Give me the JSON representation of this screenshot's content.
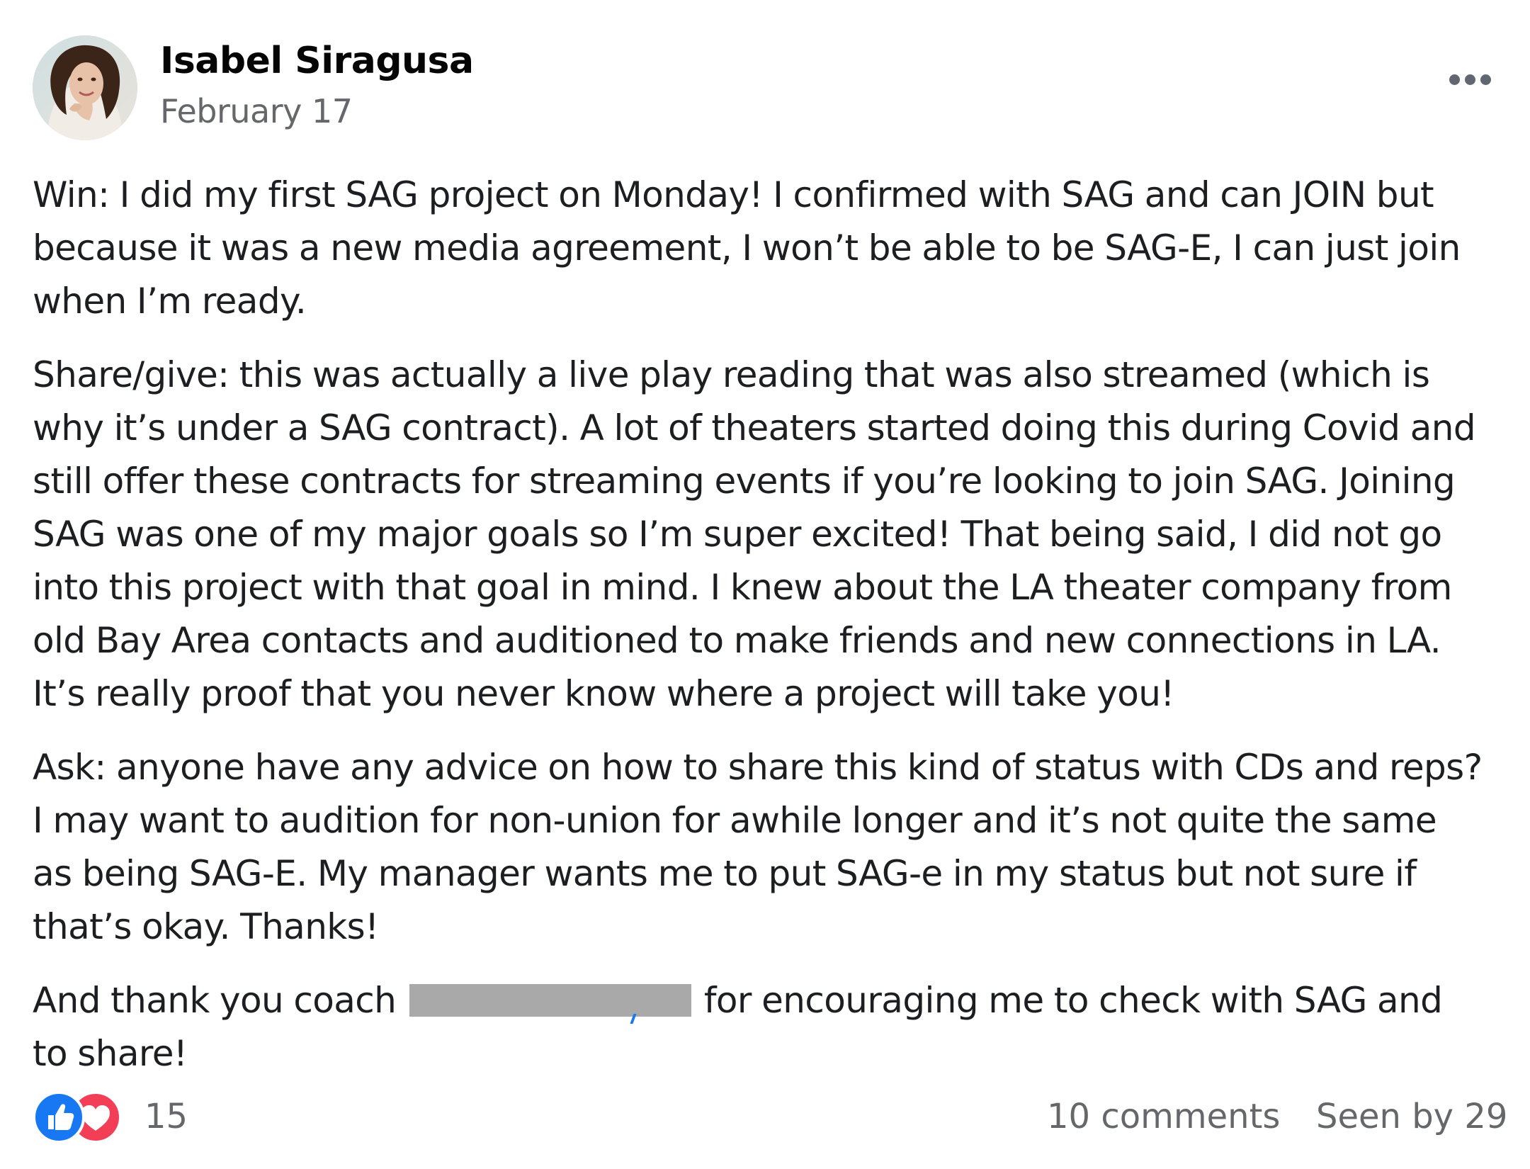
{
  "post": {
    "author_name": "Isabel Siragusa",
    "date": "February 17",
    "avatar_icon": "profile-photo",
    "more_icon": "ellipsis-icon",
    "paragraphs": [
      {
        "lines": [
          "Win: I did my first SAG project on Monday! I confirmed with SAG and can JOIN but",
          "because it was a new media agreement, I won’t be able to be SAG-E, I can just join",
          "when I’m ready."
        ]
      },
      {
        "lines": [
          "Share/give: this was actually a live play reading that was also streamed (which is",
          "why it’s under a SAG contract). A lot of theaters started doing this during Covid and",
          "still offer these contracts for streaming events if you’re looking to join SAG. Joining",
          "SAG was one of my major goals so I’m super excited! That being said, I did not go",
          "into this project with that goal in mind. I knew about the LA theater company from",
          "old Bay Area contacts and auditioned to make friends and new connections in LA.",
          "It’s really proof that you never know where a project will take you!"
        ]
      },
      {
        "lines": [
          "Ask: anyone have any advice on how to share this kind of status with CDs and reps?",
          "I may want to audition for non-union for awhile longer and it’s not quite the same",
          "as being SAG-E. My manager wants me to put SAG-e in my status but not sure if",
          "that’s okay. Thanks!"
        ]
      }
    ],
    "closing": {
      "before_redaction": "And thank you coach ",
      "after_redaction": " for encouraging me to check with SAG and",
      "second_line": "to share!"
    }
  },
  "footer": {
    "reaction_icons": [
      "like-icon",
      "love-icon"
    ],
    "reaction_count": "15",
    "comments_label": "10 comments",
    "seen_by_label": "Seen by 29"
  },
  "colors": {
    "primary_text": "#1c1e21",
    "secondary_text": "#65676b",
    "like_blue": "#1877f2",
    "love_red": "#f33e58",
    "redaction_gray": "#a9a9a9"
  }
}
